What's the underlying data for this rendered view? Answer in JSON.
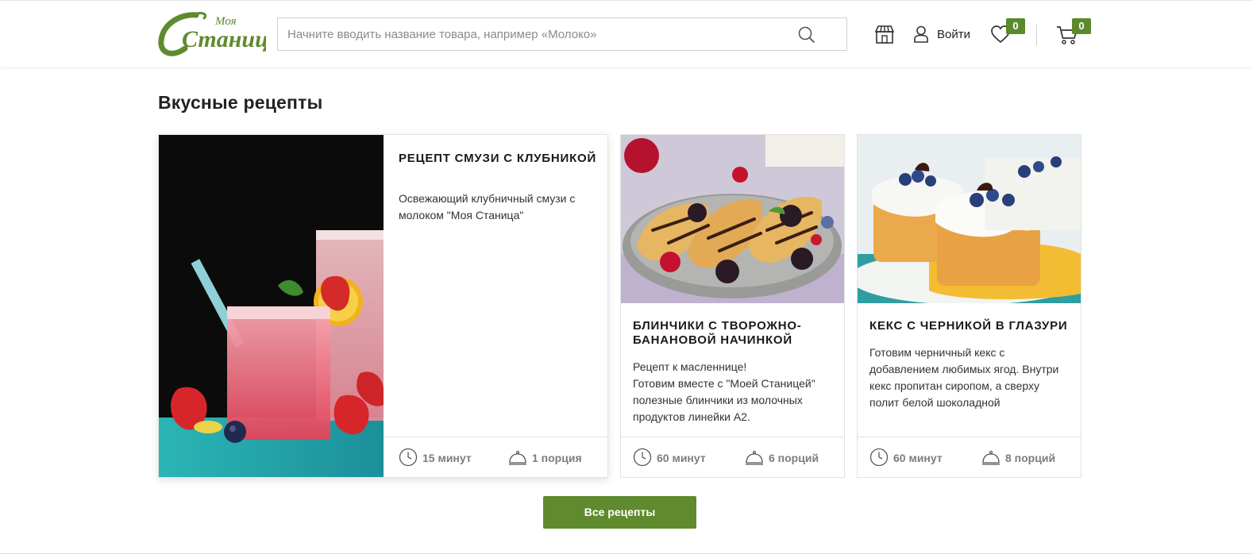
{
  "header": {
    "logo": {
      "top_text": "Моя",
      "main_text": "Станица"
    },
    "search": {
      "placeholder": "Начните вводить название товара, например «Молоко»",
      "value": ""
    },
    "icons": {
      "search": "search-icon",
      "store": "store-icon",
      "user": "user-icon",
      "favorites": "heart-icon",
      "cart": "cart-icon"
    },
    "login_label": "Войти",
    "favorites_count": "0",
    "cart_count": "0"
  },
  "section": {
    "title": "Вкусные рецепты"
  },
  "recipes": [
    {
      "title": "Рецепт смузи с клубникой",
      "description": "Освежающий клубничный смузи с молоком \"Моя Станица\"",
      "time": "15 минут",
      "portions": "1 порция"
    },
    {
      "title": "Блинчики с творожно-банановой начинкой",
      "description": "Рецепт к масленнице!\nГотовим вместе с \"Моей Станицей\" полезные блинчики из молочных продуктов линейки А2.",
      "time": "60 минут",
      "portions": "6 порций"
    },
    {
      "title": "Кекс с черникой в глазури",
      "description": "Готовим черничный кекс с добавлением  любимых ягод. Внутри кекс пропитан сиропом, а сверху полит белой шоколадной",
      "time": "60 минут",
      "portions": "8 порций"
    }
  ],
  "all_button": "Все рецепты",
  "colors": {
    "brand_green": "#5f8a2e",
    "badge_green": "#5b8a2b"
  }
}
